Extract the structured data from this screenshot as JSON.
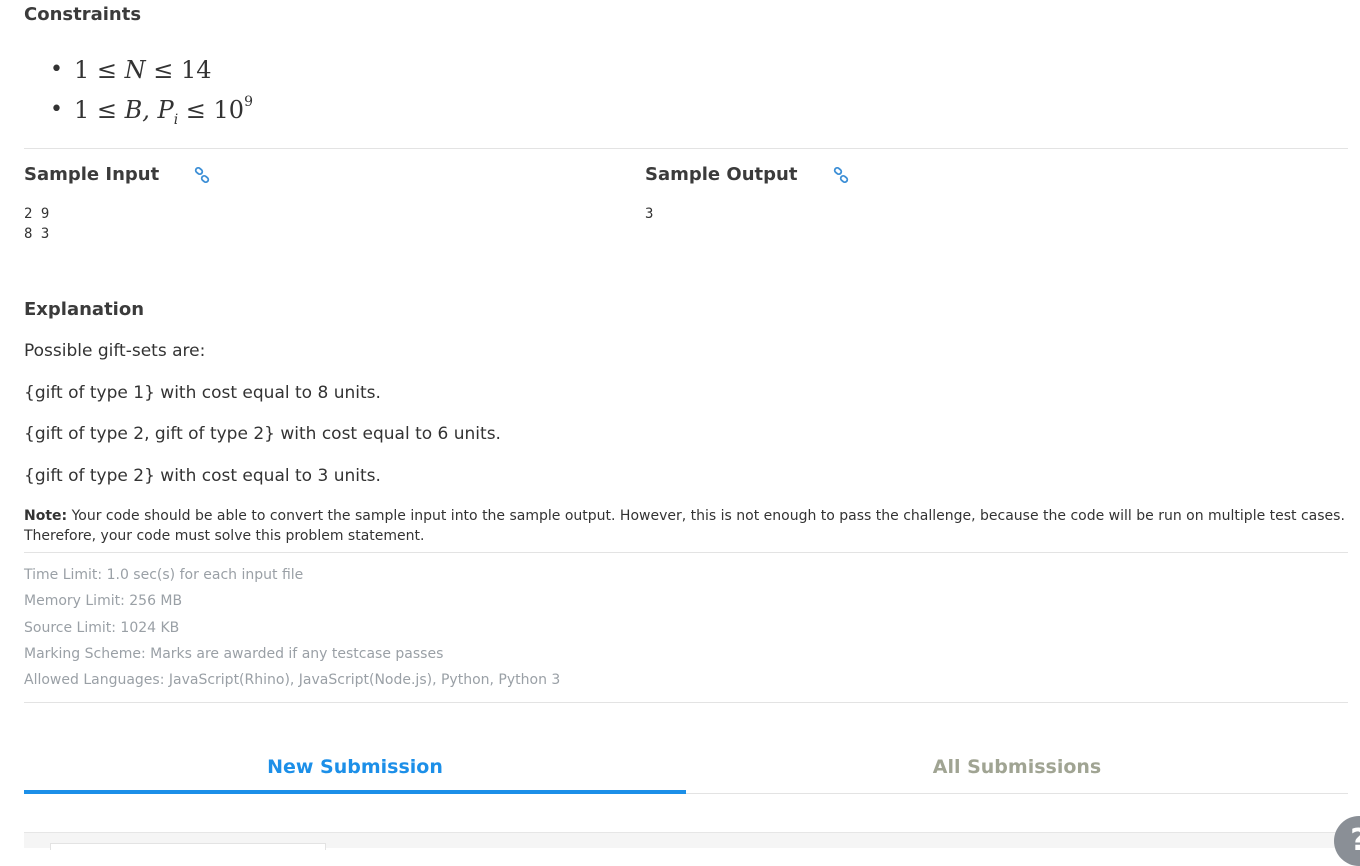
{
  "constraints": {
    "heading": "Constraints",
    "items": [
      {
        "lhs": "1 ≤ ",
        "var": "N",
        "rhs": " ≤ 14"
      },
      {
        "lhs": "1 ≤ ",
        "var": "B, P",
        "sub": "i",
        "rhs": " ≤ 10",
        "sup": "9"
      }
    ]
  },
  "sample_input": {
    "heading": "Sample Input",
    "icon": "link-icon",
    "lines": "2 9\n8 3"
  },
  "sample_output": {
    "heading": "Sample Output",
    "icon": "link-icon",
    "lines": "3"
  },
  "explanation": {
    "heading": "Explanation",
    "paragraphs": [
      "Possible gift-sets are:",
      "{gift of type 1} with cost equal to 8 units.",
      "{gift of type 2, gift of type 2} with cost equal to 6 units.",
      "{gift of type 2} with cost equal to 3 units."
    ]
  },
  "note": {
    "label": "Note:",
    "text": " Your code should be able to convert the sample input into the sample output. However, this is not enough to pass the challenge, because the code will be run on multiple test cases. Therefore, your code must solve this problem statement."
  },
  "limits": [
    "Time Limit: 1.0 sec(s) for each input file",
    "Memory Limit: 256 MB",
    "Source Limit: 1024 KB",
    "Marking Scheme: Marks are awarded if any testcase passes",
    "Allowed Languages: JavaScript(Rhino), JavaScript(Node.js), Python, Python 3"
  ],
  "tabs": {
    "new_submission": "New Submission",
    "all_submissions": "All Submissions",
    "active": "new_submission"
  },
  "help": {
    "icon": "question-icon",
    "label": "?"
  },
  "colors": {
    "accent": "#1c8fe8",
    "muted_text": "#9aa0a6",
    "inactive_tab": "#a0a493"
  }
}
